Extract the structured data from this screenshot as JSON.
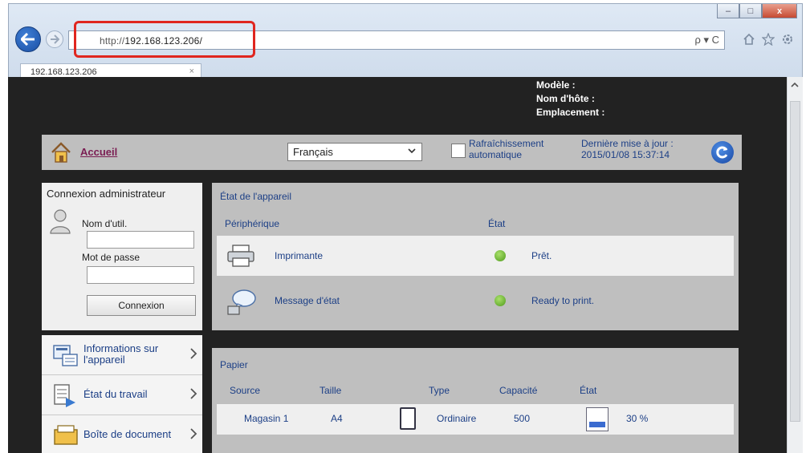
{
  "browser": {
    "url_prefix": "http://",
    "url_host": "192.168.123.206/",
    "tab_title": "192.168.123.206",
    "tab_close": "×",
    "search_tools": "ρ ▾ C",
    "win_min": "–",
    "win_max": "□",
    "win_close": "x"
  },
  "device_info": {
    "model_label": "Modèle :",
    "hostname_label": "Nom d'hôte :",
    "location_label": "Emplacement :"
  },
  "topbar": {
    "home_label": "Accueil",
    "language": "Français",
    "refresh_line1": "Rafraîchissement",
    "refresh_line2": "automatique",
    "last_update_line1": "Dernière mise à jour :",
    "last_update_line2": "2015/01/08 15:37:14"
  },
  "login": {
    "title": "Connexion administrateur",
    "username_label": "Nom d'util.",
    "password_label": "Mot de passe",
    "submit_label": "Connexion"
  },
  "sidebar": {
    "items": [
      {
        "label": "Informations sur l'appareil"
      },
      {
        "label": "État du travail"
      },
      {
        "label": "Boîte de document"
      }
    ]
  },
  "device_state": {
    "title": "État de l'appareil",
    "col_device": "Périphérique",
    "col_state": "État",
    "rows": [
      {
        "name": "Imprimante",
        "status": "Prêt."
      },
      {
        "name": "Message d'état",
        "status": "Ready to print."
      }
    ],
    "status_color": "#5fae22"
  },
  "paper": {
    "title": "Papier",
    "columns": [
      "Source",
      "Taille",
      "Type",
      "Capacité",
      "État"
    ],
    "rows": [
      {
        "source": "Magasin 1",
        "size": "A4",
        "type": "Ordinaire",
        "capacity": "500",
        "level": "30 %",
        "level_fraction": 0.3
      }
    ]
  },
  "colors": {
    "accent_link": "#7a1c52",
    "text_blue": "#1c3f86",
    "highlight": "#e0261f"
  }
}
